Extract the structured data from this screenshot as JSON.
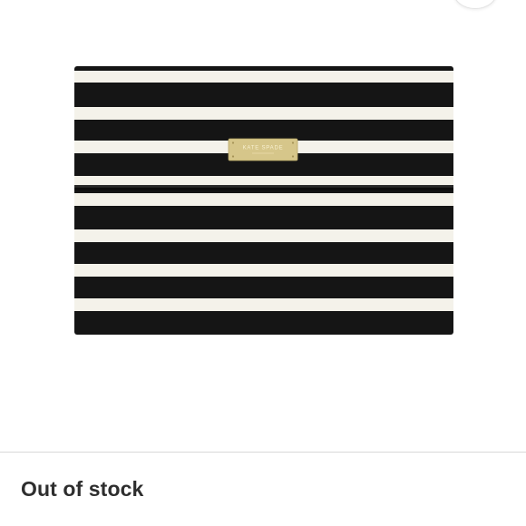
{
  "product": {
    "image_icon": "striped-clutch-image",
    "stripe_dark_color": "#151515",
    "stripe_light_color": "#f4f2ea",
    "plaque_color": "#d6c68a",
    "brand_text": "KATE SPADE"
  },
  "availability": {
    "status": "Out of stock"
  }
}
